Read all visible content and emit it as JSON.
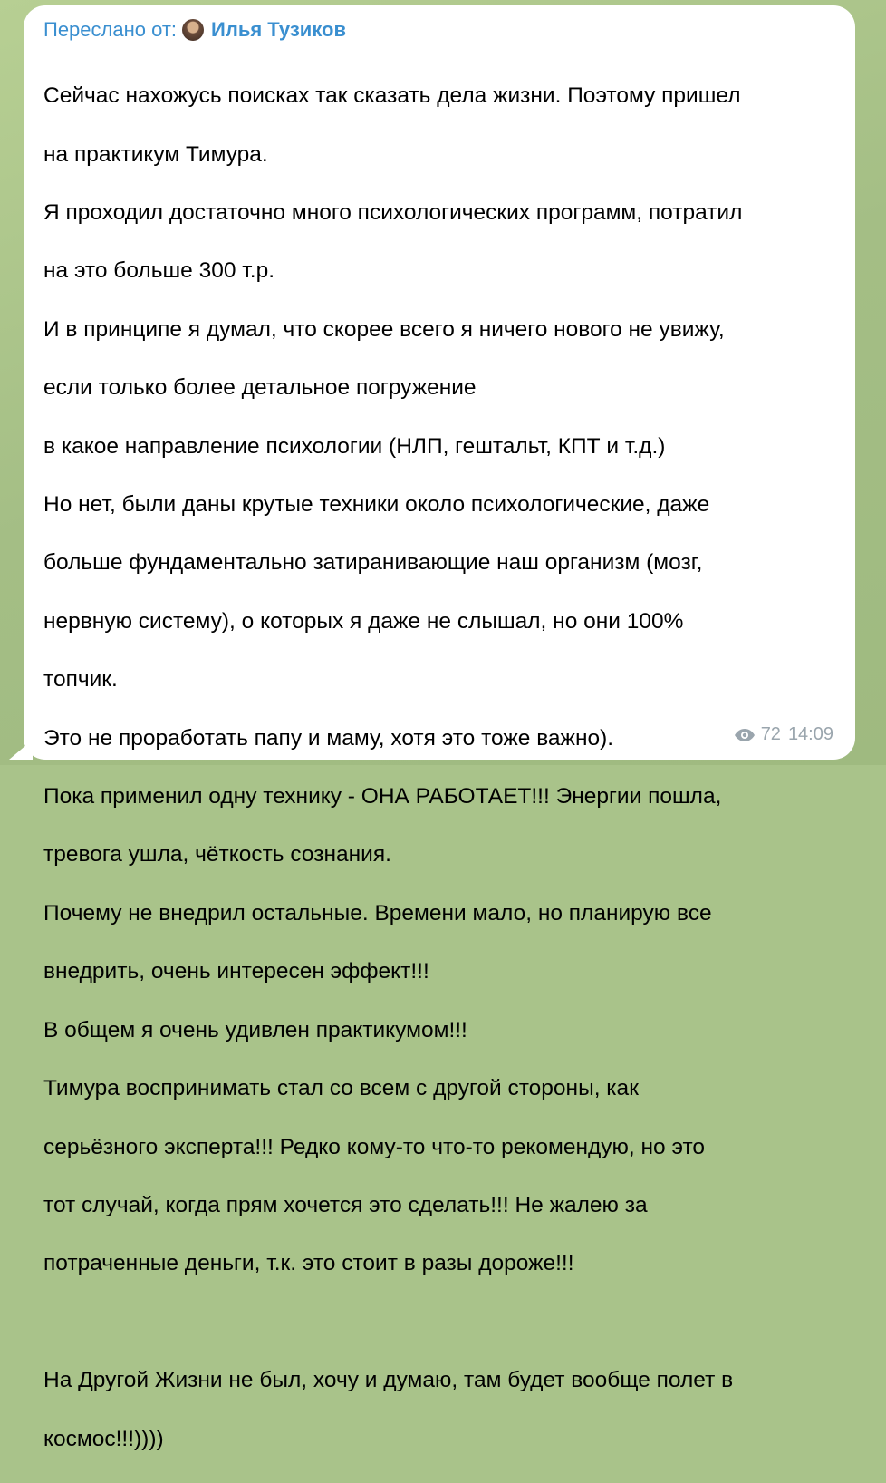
{
  "forward": {
    "prefix": "Переслано от:",
    "author": "Илья Тузиков"
  },
  "message": {
    "lines": [
      "Сейчас нахожусь поисках так сказать дела жизни. Поэтому пришел",
      "на практикум Тимура.",
      "Я проходил достаточно много психологических программ, потратил",
      "на это больше 300 т.р.",
      "И в принципе я думал, что скорее всего я ничего нового не увижу,",
      "если только более детальное погружение",
      "в какое направление психологии (НЛП, гештальт, КПТ и т.д.)",
      "Но нет, были даны крутые техники около психологические, даже",
      "больше фундаментально затиранивающие наш организм (мозг,",
      "нервную систему), о которых я даже не слышал, но они 100%",
      "топчик.",
      "Это не проработать папу и маму, хотя это тоже важно).",
      "Пока применил одну технику - ОНА РАБОТАЕТ!!! Энергии пошла,",
      "тревога ушла, чёткость сознания.",
      "Почему не внедрил остальные. Времени мало, но планирую все",
      "внедрить, очень интересен эффект!!!",
      "В общем я очень удивлен практикумом!!!",
      "Тимура воспринимать стал со всем с другой стороны, как",
      "серьёзного эксперта!!! Редко кому-то что-то рекомендую, но это",
      "тот случай, когда прям хочется это сделать!!! Не жалею за",
      "потраченные деньги, т.к. это стоит в разы дороже!!!",
      "",
      "На Другой Жизни не был, хочу и думаю, там будет вообще полет в",
      "космос!!!))))"
    ]
  },
  "meta": {
    "views": "72",
    "time": "14:09",
    "icon": "eye-icon"
  },
  "colors": {
    "accent": "#3a8fd0",
    "meta": "#9aa5ad",
    "background": "#a9c38a",
    "bubble": "#ffffff"
  }
}
